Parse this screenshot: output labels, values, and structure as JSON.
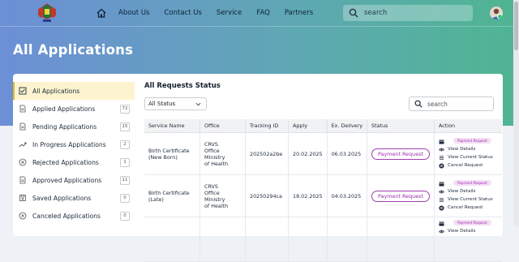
{
  "nav": {
    "links": [
      "About Us",
      "Contact Us",
      "Service",
      "FAQ",
      "Partners"
    ],
    "search_placeholder": "search"
  },
  "page_title": "All Applications",
  "sidebar": {
    "items": [
      {
        "label": "All Applications",
        "count": "",
        "icon": "all-applications-icon",
        "active": true
      },
      {
        "label": "Applied Applications",
        "count": "72",
        "icon": "document-icon"
      },
      {
        "label": "Pending Applications",
        "count": "15",
        "icon": "document-icon"
      },
      {
        "label": "In Progress Applications",
        "count": "2",
        "icon": "trend-icon"
      },
      {
        "label": "Rejected Applications",
        "count": "1",
        "icon": "circle-x-icon"
      },
      {
        "label": "Approved Applications",
        "count": "11",
        "icon": "document-icon"
      },
      {
        "label": "Saved Applications",
        "count": "0",
        "icon": "save-icon"
      },
      {
        "label": "Canceled Applications",
        "count": "0",
        "icon": "circle-x-icon"
      }
    ]
  },
  "main": {
    "title": "All Requests Status",
    "filter_value": "All Status",
    "search_placeholder": "search",
    "columns": [
      "Service Name",
      "Office",
      "Tracking ID",
      "Apply",
      "Ex. Delivery",
      "Status",
      "Action"
    ],
    "rows": [
      {
        "service": "Birth Certificate\n(New Born)",
        "office": "CRVS\nOffice Ministry\nof Health",
        "tracking": "202502a2be",
        "apply": "20.02.2025",
        "delivery": "06.03.2025",
        "status": "Payment Request",
        "pill": "Payment Request",
        "actions": [
          "View Details",
          "View Current Status",
          "Cancel Request"
        ]
      },
      {
        "service": "Birth Certificate\n(Late)",
        "office": "CRVS\nOffice Ministry\nof Health",
        "tracking": "20250294ca",
        "apply": "18.02.2025",
        "delivery": "04.03.2025",
        "status": "Payment Request",
        "pill": "Payment Request",
        "actions": [
          "View Details",
          "View Current Status",
          "Cancel Request"
        ]
      },
      {
        "pill": "Payment Request",
        "actions": [
          "View Details"
        ]
      }
    ]
  },
  "colors": {
    "accent": "#9b2fad",
    "active_bg": "#fdf4cf",
    "hero_start": "#6d8fd6",
    "hero_end": "#4fb592"
  }
}
